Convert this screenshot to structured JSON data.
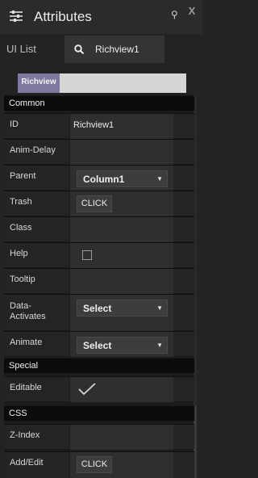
{
  "window": {
    "title": "Attributes",
    "close_label": "X"
  },
  "ui_list": {
    "label": "UI List",
    "search_value": "Richview1"
  },
  "breadcrumb": {
    "chip": "Richview"
  },
  "sections": {
    "common": "Common",
    "special": "Special",
    "css": "CSS"
  },
  "rows": {
    "id": {
      "label": "ID",
      "value": "Richview1"
    },
    "anim_delay": {
      "label": "Anim-Delay"
    },
    "parent": {
      "label": "Parent",
      "value": "Column1"
    },
    "trash": {
      "label": "Trash",
      "button": "CLICK"
    },
    "class": {
      "label": "Class"
    },
    "help": {
      "label": "Help",
      "checked": false
    },
    "tooltip": {
      "label": "Tooltip"
    },
    "data_activates": {
      "label_line1": "Data-",
      "label_line2": "Activates",
      "value": "Select"
    },
    "animate": {
      "label": "Animate",
      "value": "Select"
    },
    "editable": {
      "label": "Editable",
      "checked": true
    },
    "z_index": {
      "label": "Z-Index"
    },
    "add_edit": {
      "label": "Add/Edit",
      "button": "CLICK"
    }
  },
  "icons": {
    "title": "sliders-icon",
    "pin": "pin-icon",
    "close": "close-icon",
    "search": "search-icon",
    "dropdown": "chevron-down-icon",
    "check": "checkmark-icon"
  },
  "colors": {
    "chip": "#7e79a0",
    "panel": "#1b1b1b",
    "section": "#0b0b0b"
  }
}
